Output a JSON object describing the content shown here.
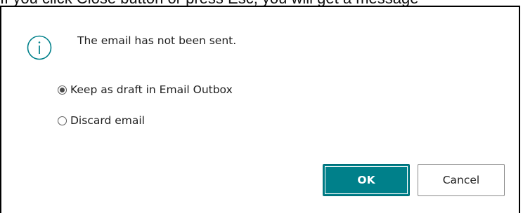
{
  "background_text": "If you click Close button or press Esc, you will get a message",
  "dialog": {
    "message": "The email has not been sent.",
    "icon": "info-icon",
    "options": [
      {
        "label": "Keep as draft in Email Outbox",
        "selected": true
      },
      {
        "label": "Discard email",
        "selected": false
      }
    ],
    "ok_label": "OK",
    "cancel_label": "Cancel"
  },
  "colors": {
    "accent": "#00808a",
    "icon": "#00808a",
    "border": "#000000"
  }
}
